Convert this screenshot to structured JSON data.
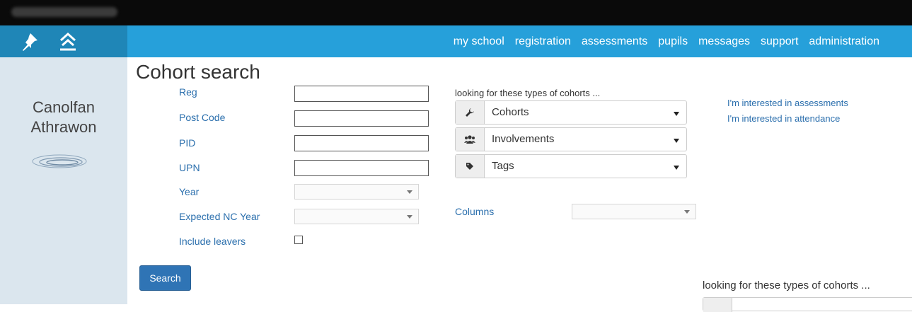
{
  "nav": {
    "links": [
      "my school",
      "registration",
      "assessments",
      "pupils",
      "messages",
      "support",
      "administration"
    ]
  },
  "sidebar": {
    "brand_line1": "Canolfan",
    "brand_line2": "Athrawon"
  },
  "page": {
    "title": "Cohort search"
  },
  "form": {
    "reg_label": "Reg",
    "postcode_label": "Post Code",
    "pid_label": "PID",
    "upn_label": "UPN",
    "year_label": "Year",
    "expected_nc_year_label": "Expected NC Year",
    "include_leavers_label": "Include leavers",
    "include_leavers_checked": false,
    "search_button": "Search"
  },
  "cohort_filters": {
    "heading": "looking for these types of cohorts ...",
    "dropdowns": [
      {
        "icon": "wrench-icon",
        "label": "Cohorts"
      },
      {
        "icon": "users-icon",
        "label": "Involvements"
      },
      {
        "icon": "tag-icon",
        "label": "Tags"
      }
    ],
    "columns_label": "Columns"
  },
  "interest_links": [
    "I'm interested in assessments",
    "I'm interested in attendance"
  ],
  "secondary_heading": "looking for these types of cohorts ...",
  "colors": {
    "nav": "#26a0da",
    "nav_left": "#1f86b7",
    "sidebar": "#dbe6ee",
    "button": "#2f74b5",
    "link": "#2b6fad"
  }
}
